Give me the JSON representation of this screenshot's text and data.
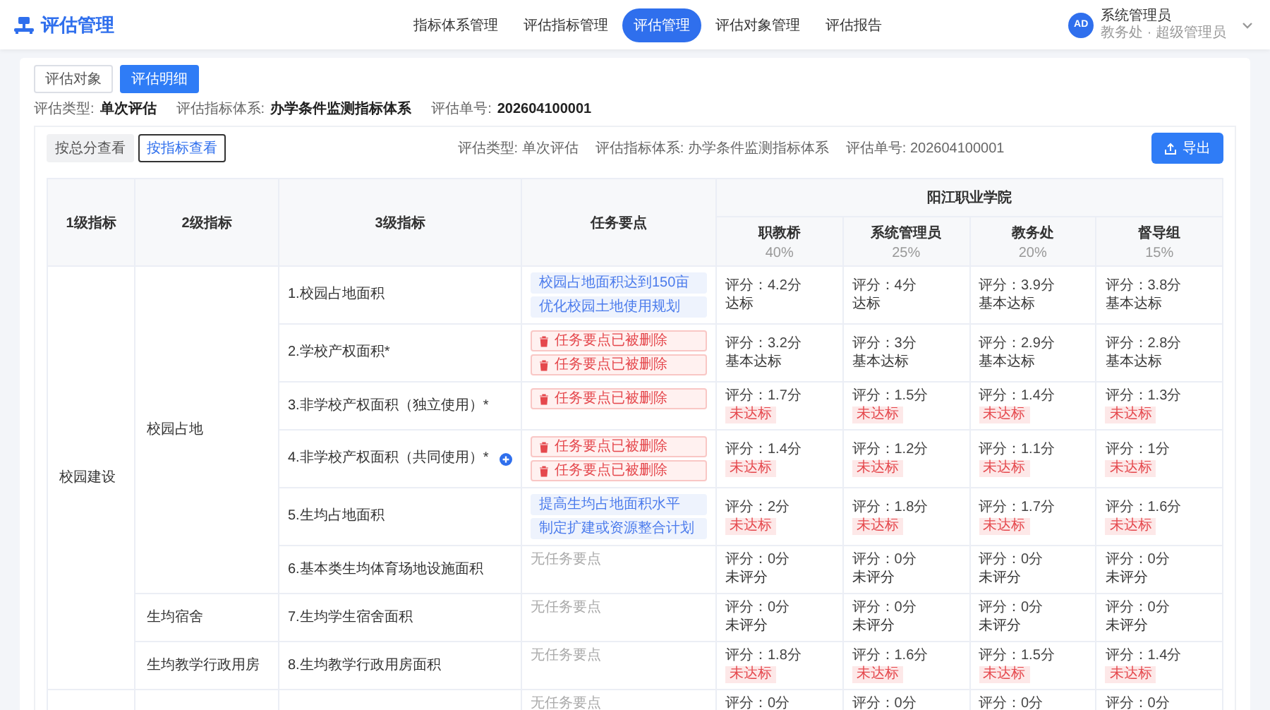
{
  "app": {
    "title": "评估管理"
  },
  "nav": [
    {
      "label": "指标体系管理",
      "selected": false
    },
    {
      "label": "评估指标管理",
      "selected": false
    },
    {
      "label": "评估管理",
      "selected": true
    },
    {
      "label": "评估对象管理",
      "selected": false
    },
    {
      "label": "评估报告",
      "selected": false
    }
  ],
  "user": {
    "avatar": "AD",
    "name": "系统管理员",
    "role": "教务处 · 超级管理员"
  },
  "view_tabs": [
    {
      "label": "评估对象",
      "selected": false
    },
    {
      "label": "评估明细",
      "selected": true
    }
  ],
  "info": [
    {
      "label": "评估类型:",
      "value": "单次评估"
    },
    {
      "label": "评估指标体系:",
      "value": "办学条件监测指标体系"
    },
    {
      "label": "评估单号:",
      "value": "202604100001"
    }
  ],
  "mode_tabs": [
    {
      "label": "按总分查看",
      "selected": false
    },
    {
      "label": "按指标查看",
      "selected": true
    }
  ],
  "summary": [
    "评估类型: 单次评估",
    "评估指标体系: 办学条件监测指标体系",
    "评估单号: 202604100001"
  ],
  "export_button": "导出",
  "table": {
    "columns": [
      "1级指标",
      "2级指标",
      "3级指标",
      "任务要点"
    ],
    "group": "阳江职业学院",
    "evaluators": [
      {
        "name": "职教桥",
        "weight": "40%"
      },
      {
        "name": "系统管理员",
        "weight": "25%"
      },
      {
        "name": "教务处",
        "weight": "20%"
      },
      {
        "name": "督导组",
        "weight": "15%"
      }
    ],
    "level1": [
      {
        "name": "校园建设",
        "children": [
          {
            "name": "校园占地",
            "children": [
              {
                "name": "1.校园占地面积",
                "tasks": [
                  {
                    "kind": "point",
                    "text": "校园占地面积达到150亩"
                  },
                  {
                    "kind": "point",
                    "text": "优化校园土地使用规划"
                  }
                ],
                "scores": [
                  {
                    "score": "评分：4.2分",
                    "status": "达标",
                    "alert": false
                  },
                  {
                    "score": "评分：4分",
                    "status": "达标",
                    "alert": false
                  },
                  {
                    "score": "评分：3.9分",
                    "status": "基本达标",
                    "alert": false
                  },
                  {
                    "score": "评分：3.8分",
                    "status": "基本达标",
                    "alert": false
                  }
                ]
              },
              {
                "name": "2.学校产权面积*",
                "tasks": [
                  {
                    "kind": "deleted",
                    "text": "任务要点已被删除"
                  },
                  {
                    "kind": "deleted",
                    "text": "任务要点已被删除"
                  }
                ],
                "scores": [
                  {
                    "score": "评分：3.2分",
                    "status": "基本达标",
                    "alert": false
                  },
                  {
                    "score": "评分：3分",
                    "status": "基本达标",
                    "alert": false
                  },
                  {
                    "score": "评分：2.9分",
                    "status": "基本达标",
                    "alert": false
                  },
                  {
                    "score": "评分：2.8分",
                    "status": "基本达标",
                    "alert": false
                  }
                ]
              },
              {
                "name": "3.非学校产权面积（独立使用）*",
                "tasks": [
                  {
                    "kind": "deleted",
                    "text": "任务要点已被删除"
                  }
                ],
                "scores": [
                  {
                    "score": "评分：1.7分",
                    "status": "未达标",
                    "alert": true
                  },
                  {
                    "score": "评分：1.5分",
                    "status": "未达标",
                    "alert": true
                  },
                  {
                    "score": "评分：1.4分",
                    "status": "未达标",
                    "alert": true
                  },
                  {
                    "score": "评分：1.3分",
                    "status": "未达标",
                    "alert": true
                  }
                ]
              },
              {
                "name": "4.非学校产权面积（共同使用）*",
                "action_icon": true,
                "tasks": [
                  {
                    "kind": "deleted",
                    "text": "任务要点已被删除"
                  },
                  {
                    "kind": "deleted",
                    "text": "任务要点已被删除"
                  }
                ],
                "scores": [
                  {
                    "score": "评分：1.4分",
                    "status": "未达标",
                    "alert": true
                  },
                  {
                    "score": "评分：1.2分",
                    "status": "未达标",
                    "alert": true
                  },
                  {
                    "score": "评分：1.1分",
                    "status": "未达标",
                    "alert": true
                  },
                  {
                    "score": "评分：1分",
                    "status": "未达标",
                    "alert": true
                  }
                ]
              },
              {
                "name": "5.生均占地面积",
                "tasks": [
                  {
                    "kind": "point",
                    "text": "提高生均占地面积水平"
                  },
                  {
                    "kind": "point",
                    "text": "制定扩建或资源整合计划"
                  }
                ],
                "scores": [
                  {
                    "score": "评分：2分",
                    "status": "未达标",
                    "alert": true
                  },
                  {
                    "score": "评分：1.8分",
                    "status": "未达标",
                    "alert": true
                  },
                  {
                    "score": "评分：1.7分",
                    "status": "未达标",
                    "alert": true
                  },
                  {
                    "score": "评分：1.6分",
                    "status": "未达标",
                    "alert": true
                  }
                ]
              },
              {
                "name": "6.基本类生均体育场地设施面积",
                "tasks": [
                  {
                    "kind": "none",
                    "text": "无任务要点"
                  }
                ],
                "scores": [
                  {
                    "score": "评分：0分",
                    "status": "未评分",
                    "alert": false
                  },
                  {
                    "score": "评分：0分",
                    "status": "未评分",
                    "alert": false
                  },
                  {
                    "score": "评分：0分",
                    "status": "未评分",
                    "alert": false
                  },
                  {
                    "score": "评分：0分",
                    "status": "未评分",
                    "alert": false
                  }
                ]
              }
            ]
          },
          {
            "name": "生均宿舍",
            "children": [
              {
                "name": "7.生均学生宿舍面积",
                "tasks": [
                  {
                    "kind": "none",
                    "text": "无任务要点"
                  }
                ],
                "scores": [
                  {
                    "score": "评分：0分",
                    "status": "未评分",
                    "alert": false
                  },
                  {
                    "score": "评分：0分",
                    "status": "未评分",
                    "alert": false
                  },
                  {
                    "score": "评分：0分",
                    "status": "未评分",
                    "alert": false
                  },
                  {
                    "score": "评分：0分",
                    "status": "未评分",
                    "alert": false
                  }
                ]
              }
            ]
          },
          {
            "name": "生均教学行政用房",
            "children": [
              {
                "name": "8.生均教学行政用房面积",
                "tasks": [
                  {
                    "kind": "none",
                    "text": "无任务要点"
                  }
                ],
                "scores": [
                  {
                    "score": "评分：1.8分",
                    "status": "未达标",
                    "alert": true
                  },
                  {
                    "score": "评分：1.6分",
                    "status": "未达标",
                    "alert": true
                  },
                  {
                    "score": "评分：1.5分",
                    "status": "未达标",
                    "alert": true
                  },
                  {
                    "score": "评分：1.4分",
                    "status": "未达标",
                    "alert": true
                  }
                ]
              }
            ]
          }
        ]
      },
      {
        "children": [
          {
            "children": [
              {
                "tasks": [
                  {
                    "kind": "none",
                    "text": "无任务要点"
                  }
                ],
                "scores": [
                  {
                    "score": "评分：0分"
                  },
                  {
                    "score": "评分：0分"
                  },
                  {
                    "score": "评分：0分"
                  },
                  {
                    "score": "评分：0分"
                  }
                ]
              }
            ]
          }
        ]
      }
    ]
  }
}
